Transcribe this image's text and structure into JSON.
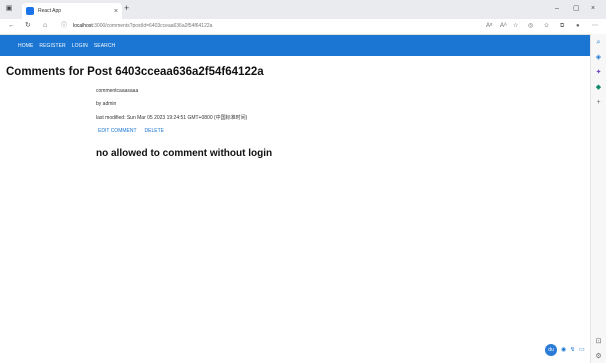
{
  "browser": {
    "tab_title": "React App",
    "tab_close": "×",
    "new_tab": "+",
    "url_host": "localhost",
    "url_rest": ":3000/comments?postId=6403cceaa636a2f54f64122a",
    "window_controls": {
      "minimize": "–",
      "maximize": "▢",
      "close": "×"
    },
    "nav": {
      "back": "←",
      "reload": "↻",
      "home": "⌂",
      "info": "ⓘ"
    }
  },
  "nav": {
    "items": [
      "HOME",
      "REGISTER",
      "LOGIN",
      "SEARCH"
    ]
  },
  "page": {
    "title": "Comments for Post 6403cceaa636a2f54f64122a",
    "comment_body": "commentcaaasaaa",
    "author": "by admin",
    "last_modified": "last modified: Sun Mar 05 2023 19:24:51 GMT+0800 (中国标准时间)",
    "actions": {
      "edit": "EDIT COMMENT",
      "delete": "DELETE"
    },
    "notice": "no allowed to comment without login"
  },
  "colors": {
    "nav_bg": "#1a76d2",
    "link": "#1a76d2"
  }
}
